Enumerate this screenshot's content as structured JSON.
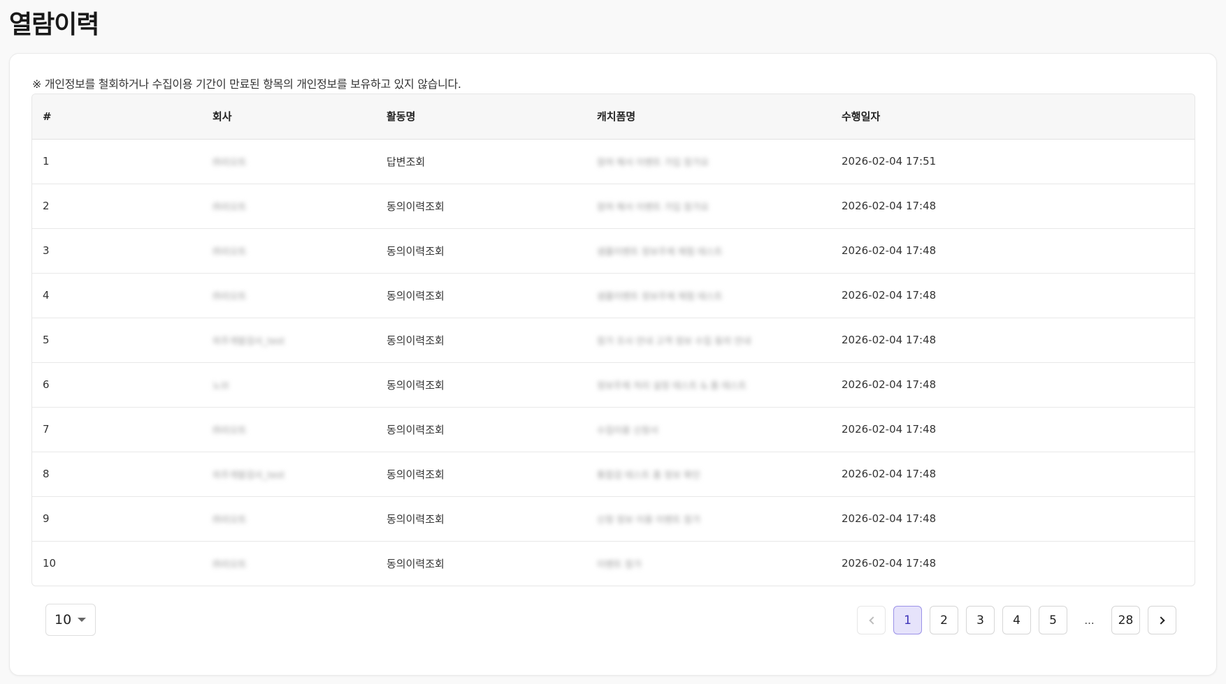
{
  "page": {
    "title": "열람이력"
  },
  "notice": "※ 개인정보를 철회하거나 수집이용 기간이 만료된 항목의 개인정보를 보유하고 있지 않습니다.",
  "table": {
    "columns": [
      "#",
      "회사",
      "활동명",
      "캐치폼명",
      "수행일자"
    ],
    "rows": [
      {
        "no": "1",
        "company": "㈜리오트",
        "activity": "답변조회",
        "form": "참여 해서 이벤트 가입 참가요",
        "date": "2026-02-04 17:51"
      },
      {
        "no": "2",
        "company": "㈜리오트",
        "activity": "동의이력조회",
        "form": "참여 해서 이벤트 가입 참가요",
        "date": "2026-02-04 17:48"
      },
      {
        "no": "3",
        "company": "㈜리오트",
        "activity": "동의이력조회",
        "form": "샘플이벤트 정보주제 체험 테스트",
        "date": "2026-02-04 17:48"
      },
      {
        "no": "4",
        "company": "㈜리오트",
        "activity": "동의이력조회",
        "form": "샘플이벤트 정보주제 체험 테스트",
        "date": "2026-02-04 17:48"
      },
      {
        "no": "5",
        "company": "외주개발검사_test",
        "activity": "동의이력조회",
        "form": "참가 조사 안내 고객 정보 수집 동의 안내",
        "date": "2026-02-04 17:48"
      },
      {
        "no": "6",
        "company": "노브",
        "activity": "동의이력조회",
        "form": "정보주제 처리 설정 테스트 & 폼 테스트",
        "date": "2026-02-04 17:48"
      },
      {
        "no": "7",
        "company": "㈜리오트",
        "activity": "동의이력조회",
        "form": "수집이용 신청서",
        "date": "2026-02-04 17:48"
      },
      {
        "no": "8",
        "company": "외주개발검사_test",
        "activity": "동의이력조회",
        "form": "통합검 테스트 폼 정보 확인",
        "date": "2026-02-04 17:48"
      },
      {
        "no": "9",
        "company": "㈜리오트",
        "activity": "동의이력조회",
        "form": "신청 정보 이용 이벤트 참가",
        "date": "2026-02-04 17:48"
      },
      {
        "no": "10",
        "company": "㈜리오트",
        "activity": "동의이력조회",
        "form": "이벤트 참가",
        "date": "2026-02-04 17:48"
      }
    ]
  },
  "pagination": {
    "page_size": "10",
    "prev_icon": "chevron-left-icon",
    "next_icon": "chevron-right-icon",
    "pages": [
      "1",
      "2",
      "3",
      "4",
      "5"
    ],
    "ellipsis": "...",
    "last_page": "28",
    "current_page": "1"
  },
  "colors": {
    "active_page_bg": "#e6e3fb",
    "active_page_border": "#9b92e8",
    "header_bg": "#f7f7f7"
  }
}
